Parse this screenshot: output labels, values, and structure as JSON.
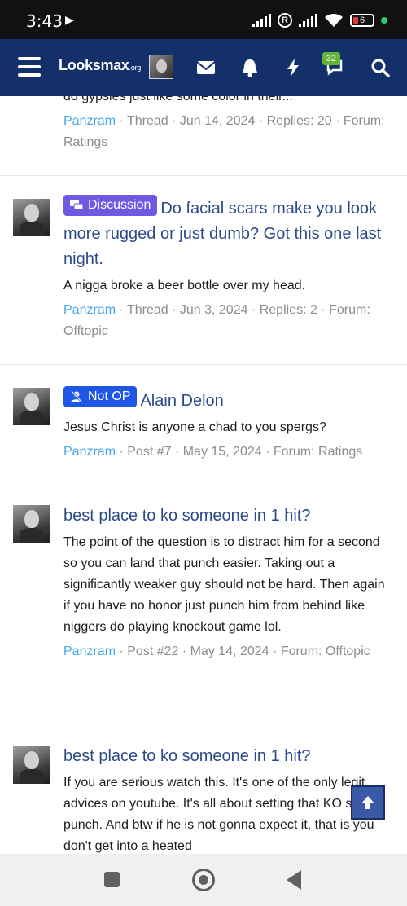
{
  "status_bar": {
    "time": "3:43",
    "battery": "6"
  },
  "header": {
    "logo_main": "Looksmax",
    "logo_sub": ".org",
    "conversations_badge": "32"
  },
  "results": [
    {
      "snippet": "do gypsies just like some color in their...",
      "user": "Panzram",
      "meta": " · Thread · Jun 14, 2024 · Replies: 20 · Forum: Ratings"
    },
    {
      "label": "Discussion",
      "title": "Do facial scars make you look more rugged or just dumb? Got this one last night.",
      "snippet": "A nigga broke a beer bottle over my head.",
      "user": "Panzram",
      "meta": " · Thread · Jun 3, 2024 · Replies: 2 · Forum: Offtopic"
    },
    {
      "label": "Not OP",
      "title": "Alain Delon",
      "snippet": "Jesus Christ is anyone a chad to you spergs?",
      "user": "Panzram",
      "meta": " · Post #7 · May 15, 2024 · Forum: Ratings"
    },
    {
      "title": "best place to ko someone in 1 hit?",
      "snippet": "The point of the question is to distract him for a second so you can land that punch easier. Taking out a significantly weaker guy should not be hard. Then again if you have no honor just punch him from behind like niggers do playing knockout game lol.",
      "user": "Panzram",
      "meta": " · Post #22 · May 14, 2024 · Forum: Offtopic"
    },
    {
      "title": "best place to ko someone in 1 hit?",
      "snippet": "If you are serious watch this. It's one of the only legit advices on youtube. It's all about setting that KO sucker punch. And btw if he is not gonna expect it, that is you don't get into a heated"
    }
  ],
  "colors": {
    "header_bg": "#13306a",
    "title_link": "#2b4a8b",
    "username": "#47a7eb",
    "label_discussion": "#7158e2",
    "label_not_op": "#1e57e6"
  }
}
